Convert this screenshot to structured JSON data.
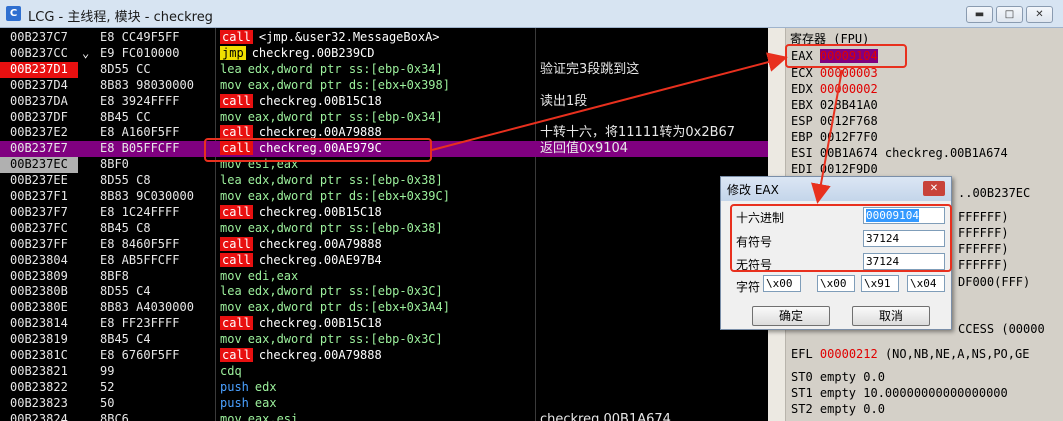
{
  "window": {
    "app_icon": "C",
    "title": "LCG - 主线程, 模块 - checkreg",
    "minimize_icon": "▬",
    "maximize_icon": "□",
    "close_icon": "✕"
  },
  "disasm_rows": [
    {
      "addr": "00B237C7",
      "mark": "",
      "hex": "E8 CC49F5FF",
      "mn": "call",
      "ops": "<jmp.&user32.MessageBoxA>",
      "comment": ""
    },
    {
      "addr": "00B237CC",
      "mark": "⌄",
      "hex": "E9 FC010000",
      "mn": "jmp",
      "ops": "checkreg.00B239CD",
      "comment": ""
    },
    {
      "addr": "00B237D1",
      "mark": "",
      "hex": "8D55 CC",
      "mn": "lea",
      "ops": "edx,dword ptr ss:[ebp-0x34]",
      "comment": "验证完3段跳到这"
    },
    {
      "addr": "00B237D4",
      "mark": "",
      "hex": "8B83 98030000",
      "mn": "mov",
      "ops": "eax,dword ptr ds:[ebx+0x398]",
      "comment": ""
    },
    {
      "addr": "00B237DA",
      "mark": "",
      "hex": "E8 3924FFFF",
      "mn": "call",
      "ops": "checkreg.00B15C18",
      "comment": "读出1段"
    },
    {
      "addr": "00B237DF",
      "mark": "",
      "hex": "8B45 CC",
      "mn": "mov",
      "ops": "eax,dword ptr ss:[ebp-0x34]",
      "comment": ""
    },
    {
      "addr": "00B237E2",
      "mark": "",
      "hex": "E8 A160F5FF",
      "mn": "call",
      "ops": "checkreg.00A79888",
      "comment": "十转十六，将11111转为0x2B67"
    },
    {
      "addr": "00B237E7",
      "mark": "",
      "hex": "E8 B05FFCFF",
      "mn": "call",
      "ops": "checkreg.00AE979C",
      "comment": "返回值0x9104"
    },
    {
      "addr": "00B237EC",
      "mark": "",
      "hex": "8BF0",
      "mn": "mov",
      "ops": "esi,eax",
      "comment": ""
    },
    {
      "addr": "00B237EE",
      "mark": "",
      "hex": "8D55 C8",
      "mn": "lea",
      "ops": "edx,dword ptr ss:[ebp-0x38]",
      "comment": ""
    },
    {
      "addr": "00B237F1",
      "mark": "",
      "hex": "8B83 9C030000",
      "mn": "mov",
      "ops": "eax,dword ptr ds:[ebx+0x39C]",
      "comment": ""
    },
    {
      "addr": "00B237F7",
      "mark": "",
      "hex": "E8 1C24FFFF",
      "mn": "call",
      "ops": "checkreg.00B15C18",
      "comment": ""
    },
    {
      "addr": "00B237FC",
      "mark": "",
      "hex": "8B45 C8",
      "mn": "mov",
      "ops": "eax,dword ptr ss:[ebp-0x38]",
      "comment": ""
    },
    {
      "addr": "00B237FF",
      "mark": "",
      "hex": "E8 8460F5FF",
      "mn": "call",
      "ops": "checkreg.00A79888",
      "comment": ""
    },
    {
      "addr": "00B23804",
      "mark": "",
      "hex": "E8 AB5FFCFF",
      "mn": "call",
      "ops": "checkreg.00AE97B4",
      "comment": ""
    },
    {
      "addr": "00B23809",
      "mark": "",
      "hex": "8BF8",
      "mn": "mov",
      "ops": "edi,eax",
      "comment": ""
    },
    {
      "addr": "00B2380B",
      "mark": "",
      "hex": "8D55 C4",
      "mn": "lea",
      "ops": "edx,dword ptr ss:[ebp-0x3C]",
      "comment": ""
    },
    {
      "addr": "00B2380E",
      "mark": "",
      "hex": "8B83 A4030000",
      "mn": "mov",
      "ops": "eax,dword ptr ds:[ebx+0x3A4]",
      "comment": ""
    },
    {
      "addr": "00B23814",
      "mark": "",
      "hex": "E8 FF23FFFF",
      "mn": "call",
      "ops": "checkreg.00B15C18",
      "comment": ""
    },
    {
      "addr": "00B23819",
      "mark": "",
      "hex": "8B45 C4",
      "mn": "mov",
      "ops": "eax,dword ptr ss:[ebp-0x3C]",
      "comment": ""
    },
    {
      "addr": "00B2381C",
      "mark": "",
      "hex": "E8 6760F5FF",
      "mn": "call",
      "ops": "checkreg.00A79888",
      "comment": ""
    },
    {
      "addr": "00B23821",
      "mark": "",
      "hex": "99",
      "mn": "cdq",
      "ops": "",
      "comment": ""
    },
    {
      "addr": "00B23822",
      "mark": "",
      "hex": "52",
      "mn": "push",
      "ops": "edx",
      "comment": ""
    },
    {
      "addr": "00B23823",
      "mark": "",
      "hex": "50",
      "mn": "push",
      "ops": "eax",
      "comment": ""
    },
    {
      "addr": "00B23824",
      "mark": "",
      "hex": "8BC6",
      "mn": "mov",
      "ops": "eax,esi",
      "comment": "checkreg.00B1A674"
    }
  ],
  "registers": {
    "header": "寄存器 (FPU)",
    "eax_name": "EAX",
    "eax_val": "00009104",
    "ecx_name": "ECX",
    "ecx_val": "00000003",
    "edx_name": "EDX",
    "edx_val": "00000002",
    "ebx": "EBX 028B41A0",
    "esp": "ESP 0012F768",
    "ebp": "EBP 0012F7F0",
    "esi": "ESI 00B1A674 checkreg.00B1A674",
    "edi": "EDI 0012F9D0",
    "eip_tail": "..00B237EC",
    "partial": [
      "FFFFFF)",
      "FFFFFF)",
      "FFFFFF)",
      "FFFFFF)",
      "DF000(FFF)"
    ],
    "access": "CCESS (00000",
    "efl_name": "EFL",
    "efl_val": "00000212",
    "efl_flags": "(NO,NB,NE,A,NS,PO,GE",
    "st0": "ST0 empty 0.0",
    "st1": "ST1 empty 10.00000000000000000",
    "st2": "ST2 empty 0.0"
  },
  "dialog": {
    "title": "修改 EAX",
    "close_icon": "✕",
    "hex_label": "十六进制",
    "hex_value": "00009104",
    "signed_label": "有符号",
    "signed_value": "37124",
    "unsigned_label": "无符号",
    "unsigned_value": "37124",
    "char_label": "字符",
    "chars": [
      "\\x00",
      "\\x00",
      "\\x91",
      "\\x04"
    ],
    "ok_label": "确定",
    "cancel_label": "取消"
  },
  "colors": {
    "annotation": "#e8301e",
    "selected_row": "#800080",
    "mnemonic_call": "#e81010",
    "mnemonic_jmp": "#f0e000"
  }
}
